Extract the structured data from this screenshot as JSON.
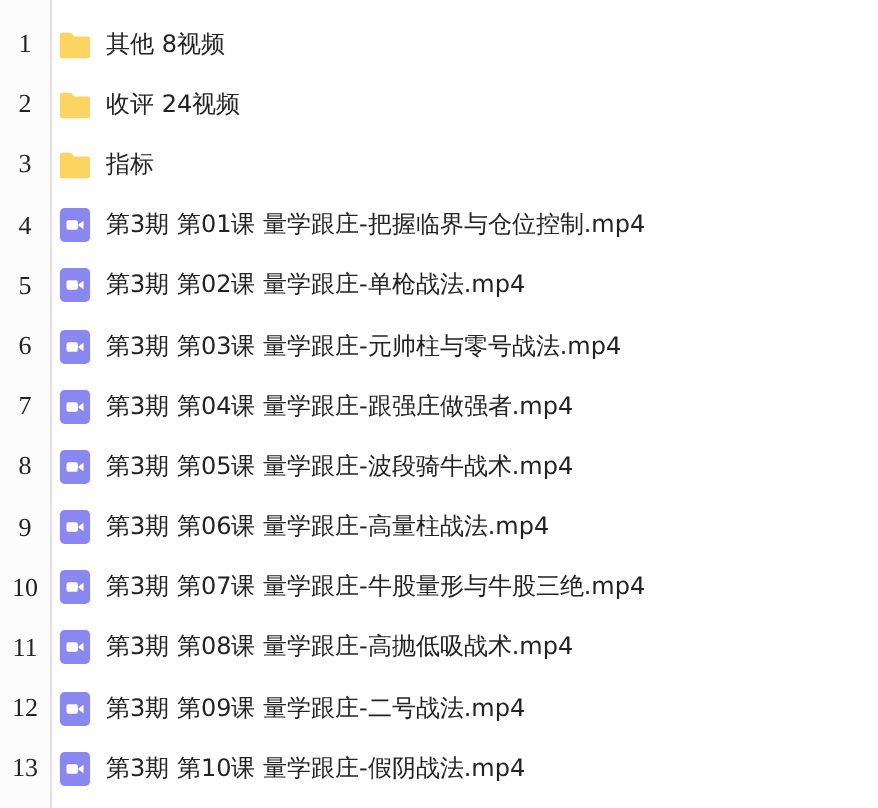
{
  "rows": [
    {
      "number": "1",
      "kind": "folder",
      "name": "其他 8视频"
    },
    {
      "number": "2",
      "kind": "folder",
      "name": "收评 24视频"
    },
    {
      "number": "3",
      "kind": "folder",
      "name": "指标"
    },
    {
      "number": "4",
      "kind": "video",
      "name": "第3期 第01课 量学跟庄-把握临界与仓位控制.mp4"
    },
    {
      "number": "5",
      "kind": "video",
      "name": "第3期 第02课 量学跟庄-单枪战法.mp4"
    },
    {
      "number": "6",
      "kind": "video",
      "name": "第3期 第03课 量学跟庄-元帅柱与零号战法.mp4"
    },
    {
      "number": "7",
      "kind": "video",
      "name": "第3期 第04课 量学跟庄-跟强庄做强者.mp4"
    },
    {
      "number": "8",
      "kind": "video",
      "name": "第3期 第05课 量学跟庄-波段骑牛战术.mp4"
    },
    {
      "number": "9",
      "kind": "video",
      "name": "第3期 第06课 量学跟庄-高量柱战法.mp4"
    },
    {
      "number": "10",
      "kind": "video",
      "name": "第3期 第07课 量学跟庄-牛股量形与牛股三绝.mp4"
    },
    {
      "number": "11",
      "kind": "video",
      "name": "第3期 第08课 量学跟庄-高抛低吸战术.mp4"
    },
    {
      "number": "12",
      "kind": "video",
      "name": "第3期 第09课 量学跟庄-二号战法.mp4"
    },
    {
      "number": "13",
      "kind": "video",
      "name": "第3期 第10课 量学跟庄-假阴战法.mp4"
    }
  ]
}
